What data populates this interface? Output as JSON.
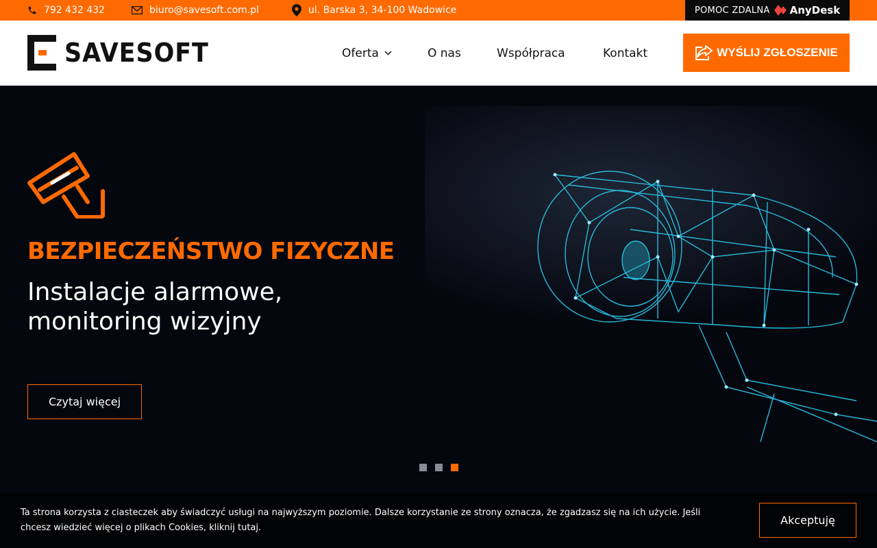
{
  "topbar": {
    "phone": "792 432 432",
    "email": "biuro@savesoft.com.pl",
    "address": "ul. Barska 3, 34-100 Wadowice",
    "remote_label": "POMOC ZDALNA",
    "remote_brand": "AnyDesk"
  },
  "header": {
    "logo_text": "SAVESOFT",
    "nav": [
      {
        "label": "Oferta"
      },
      {
        "label": "O nas"
      },
      {
        "label": "Współpraca"
      },
      {
        "label": "Kontakt"
      }
    ],
    "cta_label": "WYŚLIJ ZGŁOSZENIE"
  },
  "hero": {
    "title": "BEZPIECZEŃSTWO FIZYCZNE",
    "subtitle": "Instalacje alarmowe, monitoring wizyjny",
    "button_label": "Czytaj więcej",
    "slides": 3,
    "active_slide": 3
  },
  "cookie": {
    "text": "Ta strona korzysta z ciasteczek aby świadczyć usługi na najwyższym poziomie. Dalsze korzystanie ze strony oznacza, że zgadzasz się na ich użycie. Jeśli chcesz wiedzieć więcej o plikach Cookies, kliknij tutaj.",
    "accept_label": "Akceptuję"
  },
  "colors": {
    "accent": "#ff6a00",
    "dark": "#05070f",
    "camera": "#29c4e6"
  }
}
